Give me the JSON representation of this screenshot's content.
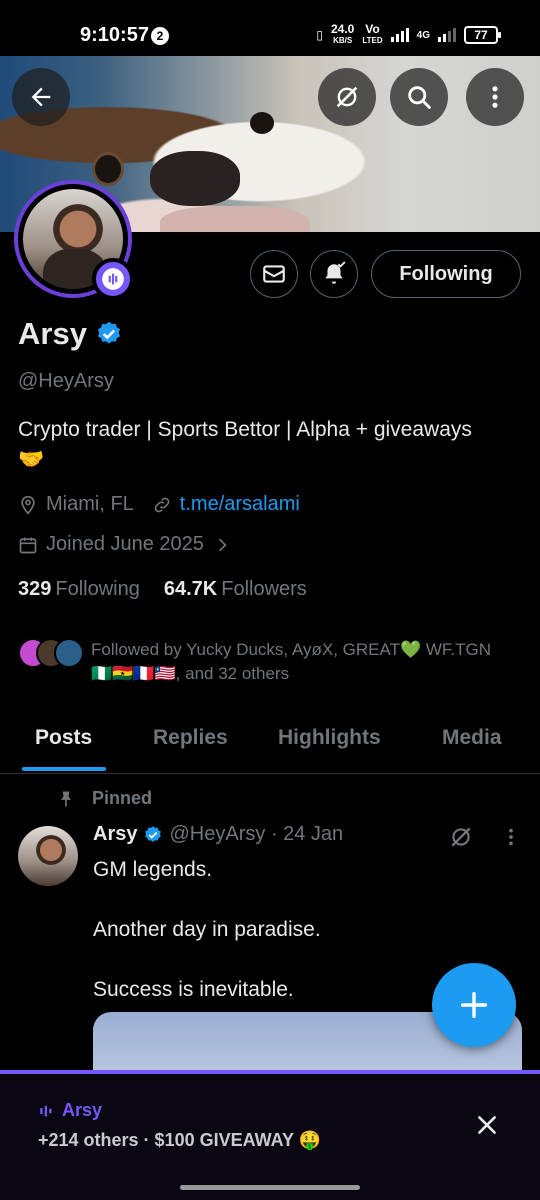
{
  "status_bar": {
    "time": "9:10:57",
    "notif_count": "2",
    "net_speed": "24.0",
    "net_unit": "KB/S",
    "carrier1": "Vo",
    "carrier2": "LTED",
    "network": "4G",
    "battery": "77"
  },
  "profile": {
    "name": "Arsy",
    "handle": "@HeyArsy",
    "bio_line": "Crypto trader | Sports Bettor | Alpha + giveaways",
    "bio_emoji": "🤝",
    "location": "Miami, FL",
    "link": "t.me/arsalami",
    "joined": "Joined June 2025",
    "following_count": "329",
    "following_label": "Following",
    "followers_count": "64.7K",
    "followers_label": "Followers",
    "followed_by": "Followed by Yucky Ducks, AyøX, GREAT💚 WF.TGN 🇳🇬🇬🇭🇫🇷🇱🇷, and 32 others",
    "follow_button": "Following"
  },
  "tabs": [
    {
      "label": "Posts"
    },
    {
      "label": "Replies"
    },
    {
      "label": "Highlights"
    },
    {
      "label": "Media"
    }
  ],
  "post": {
    "pinned_label": "Pinned",
    "author": "Arsy",
    "handle_date": "@HeyArsy · 24 Jan",
    "lines": [
      "GM legends.",
      "Another day in paradise.",
      "Success is inevitable."
    ]
  },
  "spaces_bar": {
    "title": "Arsy",
    "subtitle": "+214 others · $100 GIVEAWAY 🤑"
  },
  "colors": {
    "accent": "#1d9bf0",
    "spaces": "#7856ff",
    "muted": "#71767b"
  }
}
